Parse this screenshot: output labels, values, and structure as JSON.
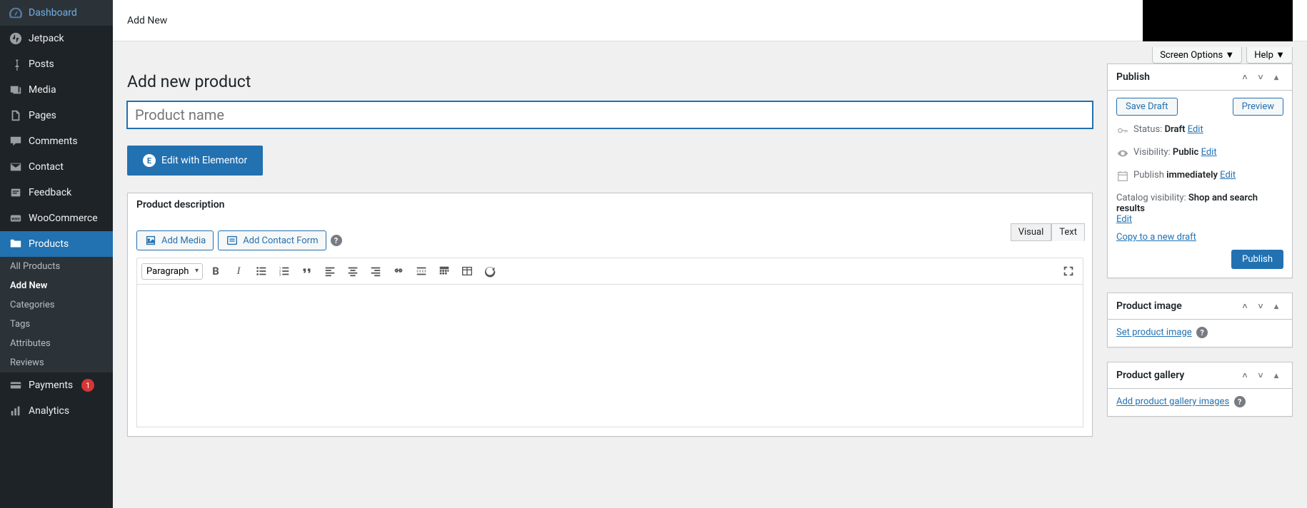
{
  "top_header": {
    "add_new": "Add New"
  },
  "screen_options": {
    "screen_options_label": "Screen Options",
    "help_label": "Help"
  },
  "sidebar": {
    "items": [
      {
        "label": "Dashboard"
      },
      {
        "label": "Jetpack"
      },
      {
        "label": "Posts"
      },
      {
        "label": "Media"
      },
      {
        "label": "Pages"
      },
      {
        "label": "Comments"
      },
      {
        "label": "Contact"
      },
      {
        "label": "Feedback"
      },
      {
        "label": "WooCommerce"
      },
      {
        "label": "Products"
      },
      {
        "label": "Payments",
        "badge": "1"
      },
      {
        "label": "Analytics"
      }
    ],
    "products_submenu": [
      {
        "label": "All Products"
      },
      {
        "label": "Add New"
      },
      {
        "label": "Categories"
      },
      {
        "label": "Tags"
      },
      {
        "label": "Attributes"
      },
      {
        "label": "Reviews"
      }
    ]
  },
  "page": {
    "title": "Add new product",
    "product_name_placeholder": "Product name",
    "elementor_button": "Edit with Elementor"
  },
  "editor": {
    "box_title": "Product description",
    "add_media": "Add Media",
    "add_contact_form": "Add Contact Form",
    "visual_tab": "Visual",
    "text_tab": "Text",
    "format_select": "Paragraph"
  },
  "publish_box": {
    "title": "Publish",
    "save_draft": "Save Draft",
    "preview": "Preview",
    "status_label": "Status:",
    "status_value": "Draft",
    "visibility_label": "Visibility:",
    "visibility_value": "Public",
    "publish_label": "Publish",
    "publish_value": "immediately",
    "catalog_label": "Catalog visibility:",
    "catalog_value": "Shop and search results",
    "edit": "Edit",
    "copy_link": "Copy to a new draft",
    "publish_button": "Publish"
  },
  "product_image_box": {
    "title": "Product image",
    "link": "Set product image"
  },
  "product_gallery_box": {
    "title": "Product gallery",
    "link": "Add product gallery images"
  }
}
